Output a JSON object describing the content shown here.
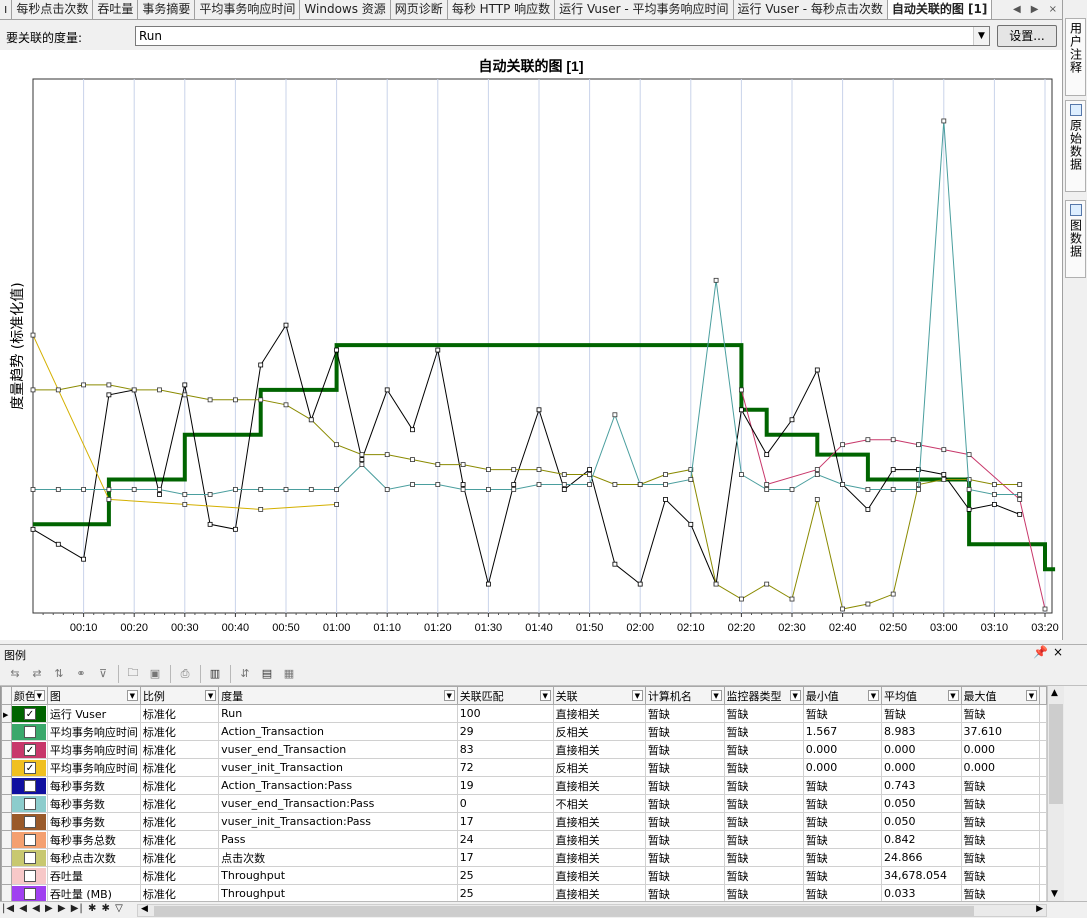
{
  "tabs": [
    {
      "label": "ı"
    },
    {
      "label": "每秒点击次数"
    },
    {
      "label": "吞吐量"
    },
    {
      "label": "事务摘要"
    },
    {
      "label": "平均事务响应时间"
    },
    {
      "label": "Windows 资源"
    },
    {
      "label": "网页诊断"
    },
    {
      "label": "每秒 HTTP 响应数"
    },
    {
      "label": "运行 Vuser - 平均事务响应时间"
    },
    {
      "label": "运行 Vuser - 每秒点击次数"
    },
    {
      "label": "自动关联的图 [1]"
    }
  ],
  "tab_nav": {
    "prev": "◀",
    "next": "▶",
    "close": "×"
  },
  "side_tabs": [
    {
      "label": "用户注释"
    },
    {
      "label": "原始数据"
    },
    {
      "label": "图数据"
    }
  ],
  "measure": {
    "label": "要关联的度量:",
    "value": "Run",
    "settings_label": "设置..."
  },
  "chart_data": {
    "type": "line",
    "title": "自动关联的图 [1]",
    "ylabel": "度量趋势 (标准化值)",
    "xlabel": "",
    "x_ticks": [
      "00:10",
      "00:20",
      "00:30",
      "00:40",
      "00:50",
      "01:00",
      "01:10",
      "01:20",
      "01:30",
      "01:40",
      "01:50",
      "02:00",
      "02:10",
      "02:20",
      "02:30",
      "02:40",
      "02:50",
      "03:00",
      "03:10",
      "03:20"
    ],
    "xlim": [
      0,
      200
    ],
    "ylim": [
      0,
      100
    ],
    "grid": true,
    "series": [
      {
        "name": "运行 Vuser",
        "color": "#006400",
        "width": 4,
        "step": true,
        "markers": false,
        "x": [
          0,
          15,
          15,
          30,
          30,
          45,
          45,
          60,
          60,
          140,
          140,
          145,
          145,
          155,
          155,
          165,
          165,
          185,
          185,
          200,
          200,
          202
        ],
        "y": [
          17,
          17,
          26,
          26,
          35,
          35,
          44,
          44,
          53,
          53,
          40,
          40,
          35,
          35,
          31,
          31,
          26,
          26,
          13,
          13,
          8,
          8
        ]
      },
      {
        "name": "Action_Transaction",
        "color": "#c8386b",
        "width": 1,
        "markers": true,
        "x": [
          140,
          145,
          155,
          160,
          165,
          170,
          175,
          180,
          185,
          195,
          200
        ],
        "y": [
          44,
          25,
          28,
          33,
          34,
          34,
          33,
          32,
          31,
          22,
          0
        ]
      },
      {
        "name": "vuser_end_Transaction",
        "color": "#000000",
        "width": 1,
        "markers": true,
        "x": [
          0,
          5,
          10,
          15,
          20,
          25,
          30,
          35,
          40,
          45,
          50,
          55,
          60,
          65,
          70,
          75,
          80,
          85,
          90,
          95,
          100,
          105,
          110,
          115,
          120,
          125,
          130,
          135,
          140,
          145,
          150,
          155,
          160,
          165,
          170,
          175,
          180,
          185,
          190,
          195
        ],
        "y": [
          16,
          13,
          10,
          43,
          44,
          23,
          45,
          17,
          16,
          49,
          57,
          38,
          52,
          30,
          44,
          36,
          52,
          25,
          5,
          25,
          40,
          24,
          28,
          9,
          5,
          22,
          17,
          5,
          40,
          31,
          38,
          48,
          25,
          20,
          28,
          28,
          27,
          20,
          21,
          19
        ]
      },
      {
        "name": "vuser_init_Transaction",
        "color": "#d4b000",
        "width": 1,
        "markers": true,
        "x": [
          0,
          15,
          30,
          45,
          60
        ],
        "y": [
          55,
          22,
          21,
          20,
          21
        ]
      },
      {
        "name": "Action_Transaction:Pass",
        "color": "#8a8a00",
        "width": 1,
        "markers": true,
        "x": [
          0,
          5,
          10,
          15,
          20,
          25,
          30,
          35,
          40,
          45,
          50,
          55,
          60,
          65,
          70,
          75,
          80,
          85,
          90,
          95,
          100,
          105,
          110,
          115,
          120,
          125,
          130,
          135,
          140,
          145,
          150,
          155,
          160,
          165,
          170,
          175,
          180,
          185,
          190,
          195
        ],
        "y": [
          44,
          44,
          45,
          45,
          44,
          44,
          43,
          42,
          42,
          42,
          41,
          38,
          33,
          31,
          31,
          30,
          29,
          29,
          28,
          28,
          28,
          27,
          27,
          25,
          25,
          27,
          28,
          5,
          2,
          5,
          2,
          22,
          0,
          1,
          3,
          25,
          26,
          26,
          25,
          25
        ]
      },
      {
        "name": "vuser_end_Transaction:Pass",
        "color": "#4a9e9e",
        "width": 1,
        "markers": true,
        "x": [
          0,
          5,
          10,
          15,
          20,
          25,
          30,
          35,
          40,
          45,
          50,
          55,
          60,
          65,
          70,
          75,
          80,
          85,
          90,
          95,
          100,
          105,
          110,
          115,
          120,
          125,
          130,
          135,
          140,
          145,
          150,
          155,
          160,
          165,
          170,
          175,
          180,
          185,
          190,
          195
        ],
        "y": [
          24,
          24,
          24,
          24,
          24,
          24,
          23,
          23,
          24,
          24,
          24,
          24,
          24,
          29,
          24,
          25,
          25,
          24,
          24,
          24,
          25,
          25,
          25,
          39,
          25,
          25,
          26,
          66,
          27,
          24,
          24,
          27,
          25,
          24,
          24,
          24,
          98,
          24,
          23,
          23
        ]
      }
    ]
  },
  "legend": {
    "title": "图例",
    "pin": "ꟷ",
    "close": "×",
    "columns": [
      "颜色",
      "图",
      "比例",
      "度量",
      "关联匹配",
      "关联",
      "计算机名",
      "监控器类型",
      "最小值",
      "平均值",
      "最大值",
      ""
    ],
    "rows": [
      {
        "color": "#006400",
        "checked": true,
        "graph": "运行 Vuser",
        "scale": "标准化",
        "measure": "Run",
        "match": "100",
        "corr": "直接相关",
        "machine": "暂缺",
        "monitor": "暂缺",
        "min": "暂缺",
        "avg": "暂缺",
        "max": "暂缺",
        "extra": "",
        "current": true
      },
      {
        "color": "#3aa86b",
        "checked": false,
        "graph": "平均事务响应时间",
        "scale": "标准化",
        "measure": "Action_Transaction",
        "match": "29",
        "corr": "反相关",
        "machine": "暂缺",
        "monitor": "暂缺",
        "min": "1.567",
        "avg": "8.983",
        "max": "37.610",
        "extra": "",
        "current": false
      },
      {
        "color": "#c8386b",
        "checked": true,
        "graph": "平均事务响应时间",
        "scale": "标准化",
        "measure": "vuser_end_Transaction",
        "match": "83",
        "corr": "直接相关",
        "machine": "暂缺",
        "monitor": "暂缺",
        "min": "0.000",
        "avg": "0.000",
        "max": "0.000",
        "extra": "",
        "current": false
      },
      {
        "color": "#f0c020",
        "checked": true,
        "graph": "平均事务响应时间",
        "scale": "标准化",
        "measure": "vuser_init_Transaction",
        "match": "72",
        "corr": "反相关",
        "machine": "暂缺",
        "monitor": "暂缺",
        "min": "0.000",
        "avg": "0.000",
        "max": "0.000",
        "extra": "",
        "current": false
      },
      {
        "color": "#1010a0",
        "checked": false,
        "graph": "每秒事务数",
        "scale": "标准化",
        "measure": "Action_Transaction:Pass",
        "match": "19",
        "corr": "直接相关",
        "machine": "暂缺",
        "monitor": "暂缺",
        "min": "暂缺",
        "avg": "0.743",
        "max": "暂缺",
        "extra": "",
        "current": false
      },
      {
        "color": "#8ccccc",
        "checked": false,
        "graph": "每秒事务数",
        "scale": "标准化",
        "measure": "vuser_end_Transaction:Pass",
        "match": "0",
        "corr": "不相关",
        "machine": "暂缺",
        "monitor": "暂缺",
        "min": "暂缺",
        "avg": "0.050",
        "max": "暂缺",
        "extra": "",
        "current": false
      },
      {
        "color": "#9a5a2a",
        "checked": false,
        "graph": "每秒事务数",
        "scale": "标准化",
        "measure": "vuser_init_Transaction:Pass",
        "match": "17",
        "corr": "直接相关",
        "machine": "暂缺",
        "monitor": "暂缺",
        "min": "暂缺",
        "avg": "0.050",
        "max": "暂缺",
        "extra": "",
        "current": false
      },
      {
        "color": "#f4a070",
        "checked": false,
        "graph": "每秒事务总数",
        "scale": "标准化",
        "measure": "Pass",
        "match": "24",
        "corr": "直接相关",
        "machine": "暂缺",
        "monitor": "暂缺",
        "min": "暂缺",
        "avg": "0.842",
        "max": "暂缺",
        "extra": "",
        "current": false
      },
      {
        "color": "#c8c870",
        "checked": false,
        "graph": "每秒点击次数",
        "scale": "标准化",
        "measure": "点击次数",
        "match": "17",
        "corr": "直接相关",
        "machine": "暂缺",
        "monitor": "暂缺",
        "min": "暂缺",
        "avg": "24.866",
        "max": "暂缺",
        "extra": "",
        "current": false
      },
      {
        "color": "#f7c8c8",
        "checked": false,
        "graph": "吞吐量",
        "scale": "标准化",
        "measure": "Throughput",
        "match": "25",
        "corr": "直接相关",
        "machine": "暂缺",
        "monitor": "暂缺",
        "min": "暂缺",
        "avg": "34,678.054",
        "max": "暂缺",
        "extra": "",
        "current": false
      },
      {
        "color": "#a040f0",
        "checked": false,
        "graph": "吞吐量 (MB)",
        "scale": "标准化",
        "measure": "Throughput",
        "match": "25",
        "corr": "直接相关",
        "machine": "暂缺",
        "monitor": "暂缺",
        "min": "暂缺",
        "avg": "0.033",
        "max": "暂缺",
        "extra": "",
        "current": false
      }
    ]
  },
  "record_nav": "|◀ ◀ ◀ ▶ ▶ ▶| ✱ ✱ ▽"
}
